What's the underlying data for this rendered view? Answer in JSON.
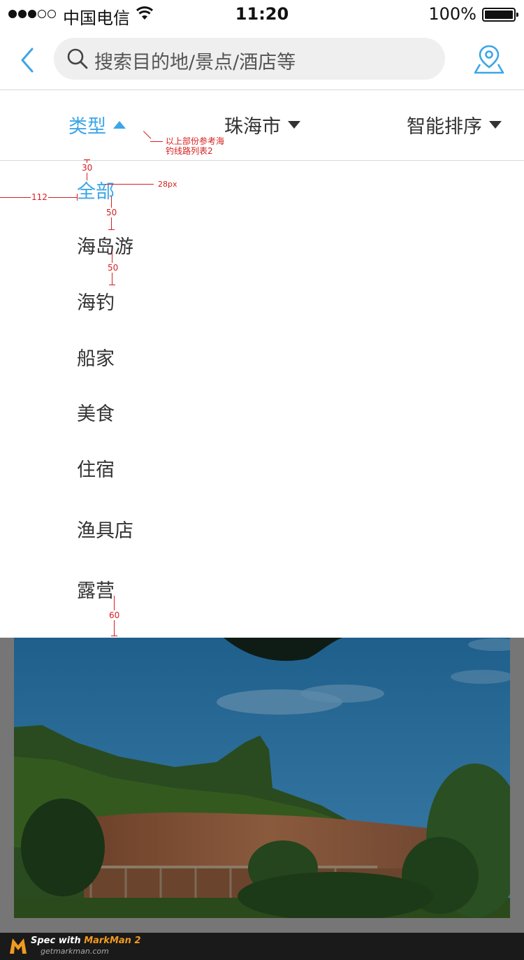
{
  "status_bar": {
    "carrier": "中国电信",
    "time": "11:20",
    "battery_percent": "100%",
    "signal_bars_filled": 3,
    "signal_bars_total": 5
  },
  "nav": {
    "search_placeholder": "搜索目的地/景点/酒店等",
    "back_icon": "chevron-left-icon",
    "location_icon": "map-pin-icon",
    "search_icon": "search-icon"
  },
  "filter_bar": {
    "tabs": [
      {
        "label": "类型",
        "active": true
      },
      {
        "label": "珠海市",
        "active": false
      },
      {
        "label": "智能排序",
        "active": false
      }
    ]
  },
  "dropdown": {
    "items": [
      {
        "label": "全部",
        "selected": true
      },
      {
        "label": "海岛游",
        "selected": false
      },
      {
        "label": "海钓",
        "selected": false
      },
      {
        "label": "船家",
        "selected": false
      },
      {
        "label": "美食",
        "selected": false
      },
      {
        "label": "住宿",
        "selected": false
      },
      {
        "label": "渔具店",
        "selected": false
      },
      {
        "label": "露营",
        "selected": false
      }
    ]
  },
  "annotations": {
    "note_line1": "以上部份参考海",
    "note_line2": "钓线路列表2",
    "top_gap": "30",
    "font_size": "28px",
    "left_gap": "112",
    "item_gap_1": "50",
    "item_gap_2": "50",
    "bottom_gap": "60"
  },
  "footer": {
    "spec_prefix": "Spec with ",
    "brand": "MarkMan 2",
    "url": "getmarkman.com"
  },
  "colors": {
    "accent": "#3ca6e8",
    "text": "#333333",
    "annotation": "#d81e1e",
    "overlay": "#767676"
  }
}
